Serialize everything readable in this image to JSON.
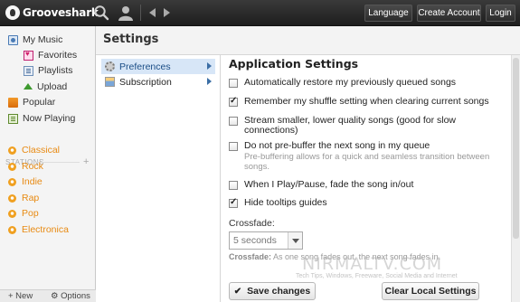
{
  "topbar": {
    "logo_text": "Grooveshark",
    "buttons": {
      "language": "Language",
      "create_account": "Create Account",
      "login": "Login"
    }
  },
  "sidebar": {
    "my_music": "My Music",
    "favorites": "Favorites",
    "playlists": "Playlists",
    "upload": "Upload",
    "popular": "Popular",
    "now_playing": "Now Playing",
    "stations_header": "STATIONS",
    "stations_add": "+",
    "stations": [
      "Classical",
      "Rock",
      "Indie",
      "Rap",
      "Pop",
      "Electronica"
    ],
    "footer": {
      "new": "+ New",
      "options": "⚙ Options"
    }
  },
  "main": {
    "title": "Settings",
    "nav": [
      {
        "label": "Preferences",
        "icon": "gear-icon",
        "active": true
      },
      {
        "label": "Subscription",
        "icon": "card-icon",
        "active": false
      }
    ]
  },
  "app_settings": {
    "title": "Application Settings",
    "options": [
      {
        "label": "Automatically restore my previously queued songs",
        "checked": false,
        "hint": ""
      },
      {
        "label": "Remember my shuffle setting when clearing current songs",
        "checked": true,
        "hint": ""
      },
      {
        "label": "Stream smaller, lower quality songs (good for slow connections)",
        "checked": false,
        "hint": ""
      },
      {
        "label": "Do not pre-buffer the next song in my queue",
        "checked": false,
        "hint": "Pre-buffering allows for a quick and seamless transition between songs."
      },
      {
        "label": "When I Play/Pause, fade the song in/out",
        "checked": false,
        "hint": ""
      },
      {
        "label": "Hide tooltips guides",
        "checked": true,
        "hint": ""
      }
    ],
    "crossfade_label": "Crossfade:",
    "crossfade_value": "5 seconds",
    "crossfade_desc_label": "Crossfade:",
    "crossfade_desc": "As one song fades out, the next song fades in.",
    "save_button": "Save changes",
    "clear_button": "Clear Local Settings"
  },
  "watermark": {
    "main": "NIRMALTV.COM",
    "sub": "Tech Tips, Windows, Freeware, Social Media and Internet"
  },
  "colors": {
    "accent": "#3b6ea5",
    "station": "#e88a12",
    "topbar": "#2a2a2a"
  }
}
